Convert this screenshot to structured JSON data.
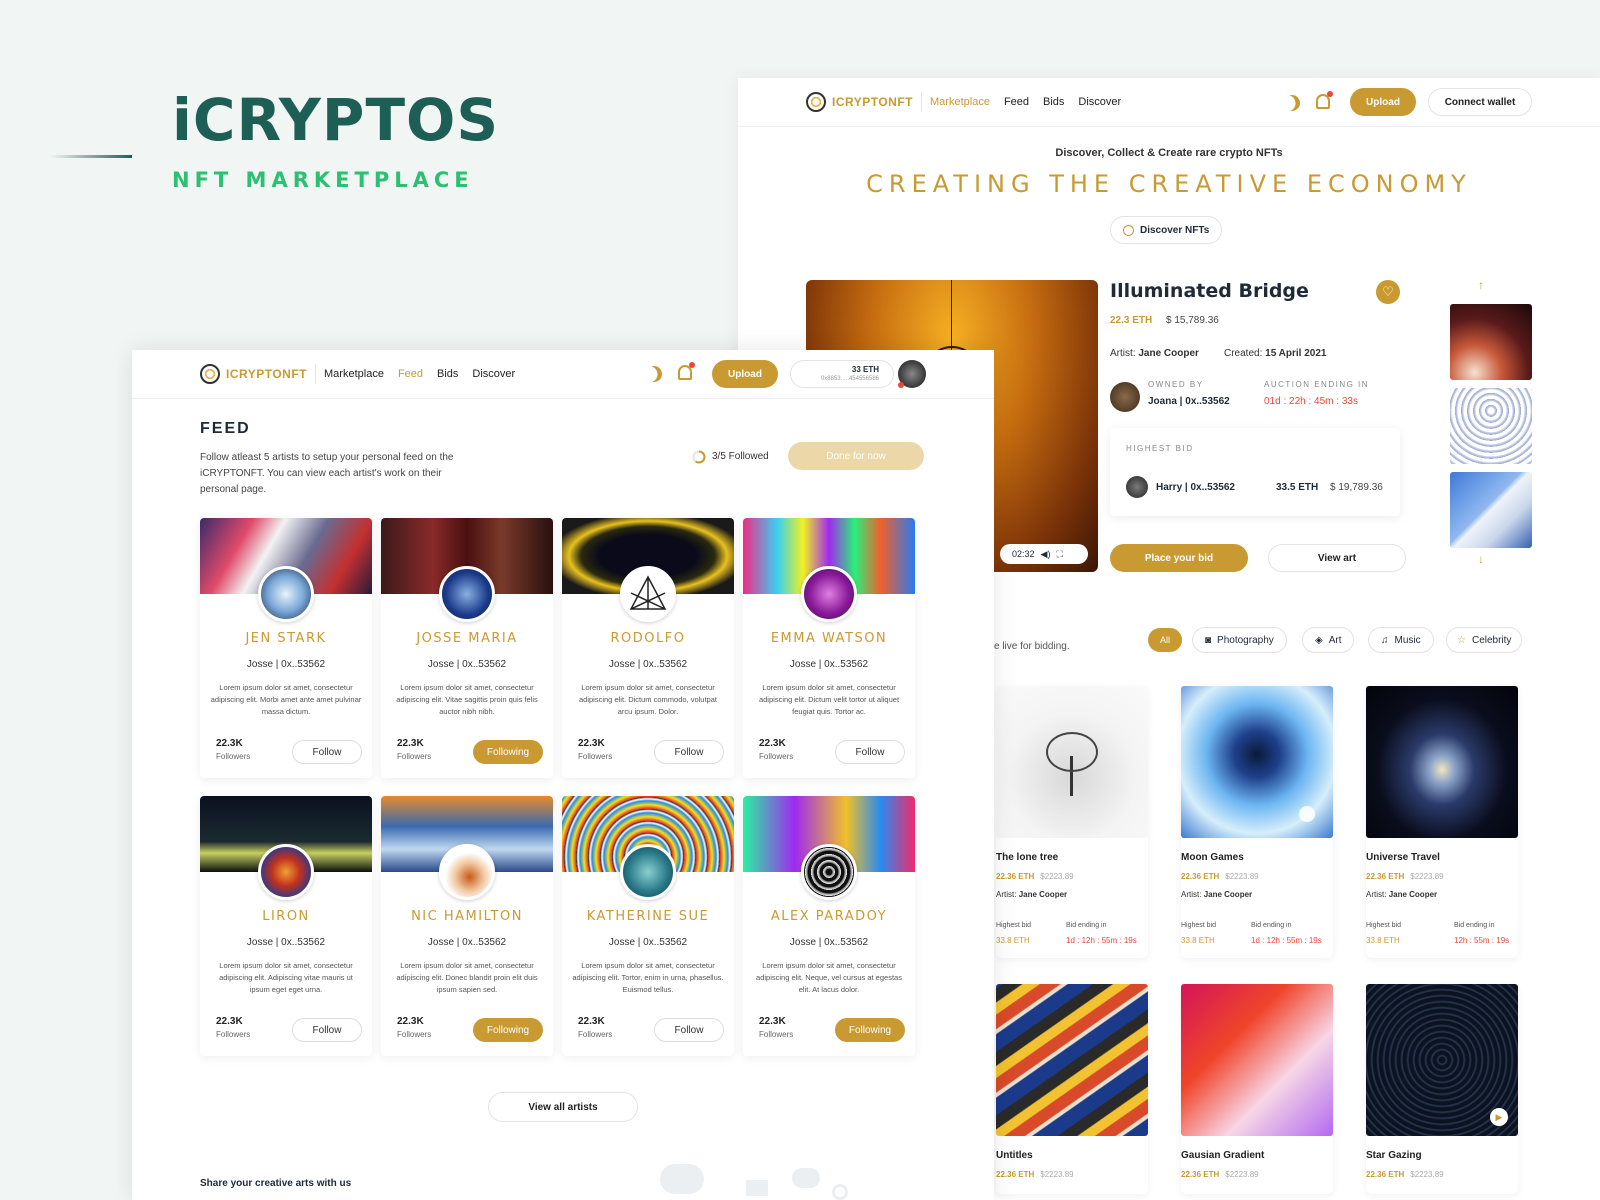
{
  "brand": {
    "title": "iCRYPTOS",
    "subtitle": "NFT MARKETPLACE"
  },
  "colors": {
    "accent": "#c99a32",
    "brand": "#1d5f55",
    "green": "#2bc072",
    "red": "#f04438"
  },
  "marketplace": {
    "nav": {
      "logo": "ICRYPTONFT",
      "links": [
        "Marketplace",
        "Feed",
        "Bids",
        "Discover"
      ],
      "active": "Marketplace",
      "upload": "Upload",
      "connect": "Connect wallet"
    },
    "hero": {
      "subtitle": "Discover, Collect & Create rare crypto NFTs",
      "title": "CREATING THE CREATIVE ECONOMY",
      "discover_button": "Discover NFTs"
    },
    "featured": {
      "title": "Illuminated Bridge",
      "eth": "22.3 ETH",
      "usd": "$ 15,789.36",
      "artist_label": "Artist:",
      "artist": "Jane Cooper",
      "created_label": "Created:",
      "created": "15 April 2021",
      "owned_by_label": "OWNED BY",
      "owner": "Joana | 0x..53562",
      "auction_label": "AUCTION ENDING IN",
      "auction_time": "01d : 22h : 45m : 33s",
      "highest_bid_label": "HIGHEST BID",
      "bidder": "Harry | 0x..53562",
      "bid_eth": "33.5 ETH",
      "bid_usd": "$ 19,789.36",
      "video_time": "02:32",
      "place_bid": "Place your bid",
      "view_art": "View art"
    },
    "live_text": "e live for bidding.",
    "filters": [
      "All",
      "Photography",
      "Art",
      "Music",
      "Celebrity"
    ],
    "arts": [
      {
        "title": "The lone tree",
        "eth": "22.36 ETH",
        "usd": "$2223.89",
        "artist": "Jane Cooper",
        "hb_label": "Highest bid",
        "hb": "33.8 ETH",
        "end_label": "Bid ending in",
        "end": "1d : 12h : 55m : 19s"
      },
      {
        "title": "Moon Games",
        "eth": "22.36 ETH",
        "usd": "$2223.89",
        "artist": "Jane Cooper",
        "hb_label": "Highest bid",
        "hb": "33.8 ETH",
        "end_label": "Bid ending in",
        "end": "1d : 12h : 55m : 19s"
      },
      {
        "title": "Universe Travel",
        "eth": "22.36 ETH",
        "usd": "$2223.89",
        "artist": "Jane Cooper",
        "hb_label": "Highest bid",
        "hb": "33.8 ETH",
        "end_label": "Bid ending in",
        "end": "12h : 55m : 19s"
      },
      {
        "title": "Untitles",
        "eth": "22.36 ETH",
        "usd": "$2223.89"
      },
      {
        "title": "Gausian Gradient",
        "eth": "22.36 ETH",
        "usd": "$2223.89"
      },
      {
        "title": "Star Gazing",
        "eth": "22.36 ETH",
        "usd": "$2223.89"
      }
    ],
    "artist_prefix": "Artist:"
  },
  "feed": {
    "nav": {
      "logo": "ICRYPTONFT",
      "links": [
        "Marketplace",
        "Feed",
        "Bids",
        "Discover"
      ],
      "active": "Feed",
      "upload": "Upload",
      "wallet_eth": "33 ETH",
      "wallet_addr": "0x8853.....454556586"
    },
    "title": "FEED",
    "intro": "Follow atleast 5 artists to setup your personal feed on the iCRYPTONFT. You can view each artist's work on their personal page.",
    "progress": "3/5 Followed",
    "progress_fraction": 0.6,
    "done": "Done for now",
    "followers_label": "Followers",
    "artists": [
      {
        "name": "JEN STARK",
        "handle": "Josse | 0x..53562",
        "desc": "Lorem ipsum dolor sit amet, consectetur adipiscing elit. Morbi amet ante amet pulvinar massa dictum.",
        "followers": "22.3K",
        "button": "Follow"
      },
      {
        "name": "JOSSE MARIA",
        "handle": "Josse | 0x..53562",
        "desc": "Lorem ipsum dolor sit amet, consectetur adipiscing elit. Vitae sagittis proin quis felis auctor nibh nibh.",
        "followers": "22.3K",
        "button": "Following"
      },
      {
        "name": "RODOLFO",
        "handle": "Josse | 0x..53562",
        "desc": "Lorem ipsum dolor sit amet, consectetur adipiscing elit. Dictum commodo, volutpat arcu ipsum. Dolor.",
        "followers": "22.3K",
        "button": "Follow"
      },
      {
        "name": "EMMA WATSON",
        "handle": "Josse | 0x..53562",
        "desc": "Lorem ipsum dolor sit amet, consectetur adipiscing elit. Dictum velit tortor ut aliquet feugiat quis. Tortor ac.",
        "followers": "22.3K",
        "button": "Follow"
      },
      {
        "name": "LIRON",
        "handle": "Josse | 0x..53562",
        "desc": "Lorem ipsum dolor sit amet, consectetur adipiscing elit. Adipiscing vitae mauris ut ipsum eget eget urna.",
        "followers": "22.3K",
        "button": "Follow"
      },
      {
        "name": "NIC HAMILTON",
        "handle": "Josse | 0x..53562",
        "desc": "Lorem ipsum dolor sit amet, consectetur adipiscing elit. Donec blandit proin elit duis ipsum sapien sed.",
        "followers": "22.3K",
        "button": "Following"
      },
      {
        "name": "KATHERINE SUE",
        "handle": "Josse | 0x..53562",
        "desc": "Lorem ipsum dolor sit amet, consectetur adipiscing elit. Tortor, enim in urna, phasellus. Euismod tellus.",
        "followers": "22.3K",
        "button": "Follow"
      },
      {
        "name": "ALEX PARADOY",
        "handle": "Josse | 0x..53562",
        "desc": "Lorem ipsum dolor sit amet, consectetur adipiscing elit. Neque, vel cursus at egestas elit. At lacus dolor.",
        "followers": "22.3K",
        "button": "Following"
      }
    ],
    "view_all": "View all artists",
    "share": "Share your creative arts with us"
  }
}
